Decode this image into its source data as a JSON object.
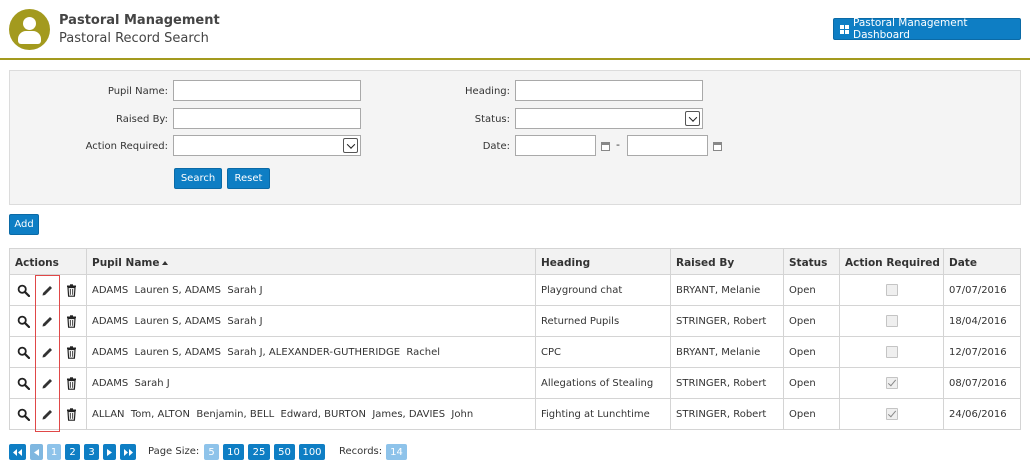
{
  "header": {
    "app_title": "Pastoral Management",
    "page_title": "Pastoral Record Search",
    "dashboard_button": "Pastoral Management Dashboard"
  },
  "search": {
    "pupil_name_label": "Pupil Name:",
    "raised_by_label": "Raised By:",
    "action_required_label": "Action Required:",
    "heading_label": "Heading:",
    "status_label": "Status:",
    "date_label": "Date:",
    "date_sep": "-",
    "pupil_name_value": "",
    "raised_by_value": "",
    "heading_value": "",
    "date_from_value": "",
    "date_to_value": "",
    "search_button": "Search",
    "reset_button": "Reset"
  },
  "add_button": "Add",
  "table": {
    "columns": [
      "Actions",
      "Pupil Name",
      "Heading",
      "Raised By",
      "Status",
      "Action Required",
      "Date"
    ],
    "rows": [
      {
        "pupil": "ADAMS  Lauren S, ADAMS  Sarah J",
        "heading": "Playground chat",
        "raised_by": "BRYANT, Melanie",
        "status": "Open",
        "action_required": false,
        "date": "07/07/2016"
      },
      {
        "pupil": "ADAMS  Lauren S, ADAMS  Sarah J",
        "heading": "Returned Pupils",
        "raised_by": "STRINGER, Robert",
        "status": "Open",
        "action_required": false,
        "date": "18/04/2016"
      },
      {
        "pupil": "ADAMS  Lauren S, ADAMS  Sarah J, ALEXANDER-GUTHERIDGE  Rachel",
        "heading": "CPC",
        "raised_by": "BRYANT, Melanie",
        "status": "Open",
        "action_required": false,
        "date": "12/07/2016"
      },
      {
        "pupil": "ADAMS  Sarah J",
        "heading": "Allegations of Stealing",
        "raised_by": "STRINGER, Robert",
        "status": "Open",
        "action_required": true,
        "date": "08/07/2016"
      },
      {
        "pupil": "ALLAN  Tom, ALTON  Benjamin, BELL  Edward, BURTON  James, DAVIES  John",
        "heading": "Fighting at Lunchtime",
        "raised_by": "STRINGER, Robert",
        "status": "Open",
        "action_required": true,
        "date": "24/06/2016"
      }
    ]
  },
  "pager": {
    "pages": [
      "1",
      "2",
      "3"
    ],
    "current_page": "1",
    "page_size_label": "Page Size:",
    "page_sizes": [
      "5",
      "10",
      "25",
      "50",
      "100"
    ],
    "selected_page_size": "5",
    "records_label": "Records:",
    "records_count": "14"
  },
  "colors": {
    "accent": "#a39a1e",
    "button": "#0e7ec4",
    "highlight": "#e04848"
  }
}
